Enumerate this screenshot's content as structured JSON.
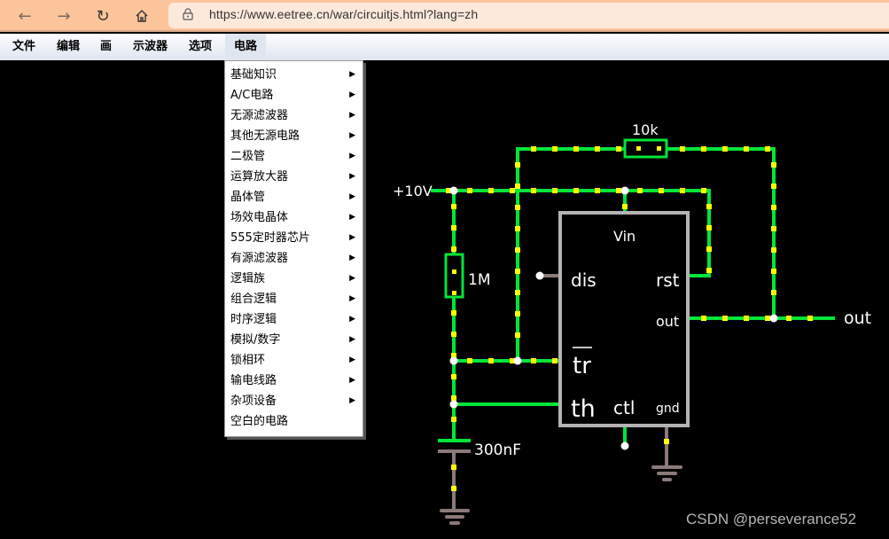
{
  "browser": {
    "back_icon": "arrow-left-icon",
    "forward_icon": "arrow-right-icon",
    "reload_icon": "reload-icon",
    "home_icon": "home-icon",
    "lock_icon": "lock-icon",
    "url": "https://www.eetree.cn/war/circuitjs.html?lang=zh"
  },
  "menubar": {
    "items": [
      {
        "label": "文件"
      },
      {
        "label": "编辑"
      },
      {
        "label": "画"
      },
      {
        "label": "示波器"
      },
      {
        "label": "选项"
      },
      {
        "label": "电路",
        "active": true
      }
    ]
  },
  "dropdown": {
    "items": [
      {
        "label": "基础知识",
        "submenu": true
      },
      {
        "label": "A/C电路",
        "submenu": true
      },
      {
        "label": "无源滤波器",
        "submenu": true
      },
      {
        "label": "其他无源电路",
        "submenu": true
      },
      {
        "label": "二极管",
        "submenu": true
      },
      {
        "label": "运算放大器",
        "submenu": true
      },
      {
        "label": "晶体管",
        "submenu": true
      },
      {
        "label": "场效电晶体",
        "submenu": true
      },
      {
        "label": "555定时器芯片",
        "submenu": true
      },
      {
        "label": "有源滤波器",
        "submenu": true
      },
      {
        "label": "逻辑族",
        "submenu": true
      },
      {
        "label": "组合逻辑",
        "submenu": true
      },
      {
        "label": "时序逻辑",
        "submenu": true
      },
      {
        "label": "模拟/数字",
        "submenu": true
      },
      {
        "label": "锁相环",
        "submenu": true
      },
      {
        "label": "输电线路",
        "submenu": true
      },
      {
        "label": "杂项设备",
        "submenu": true
      },
      {
        "label": "空白的电路",
        "submenu": false
      }
    ],
    "arrow_glyph": "▶"
  },
  "circuit": {
    "supply_label": "+10V",
    "r1_label": "10k",
    "r2_label": "1M",
    "cap_label": "300nF",
    "output_label": "out",
    "chip": {
      "vin": "Vin",
      "dis": "dis",
      "rst": "rst",
      "out": "out",
      "tr": "tr",
      "th": "th",
      "ctl": "ctl",
      "gnd": "gnd"
    },
    "colors": {
      "wire_active": "#00e53a",
      "current_dot": "#ffff00",
      "wire_ground": "#8a7a78",
      "chip_border": "#b3b3b3",
      "node": "#ffffff"
    }
  },
  "watermark": "CSDN @perseverance52"
}
